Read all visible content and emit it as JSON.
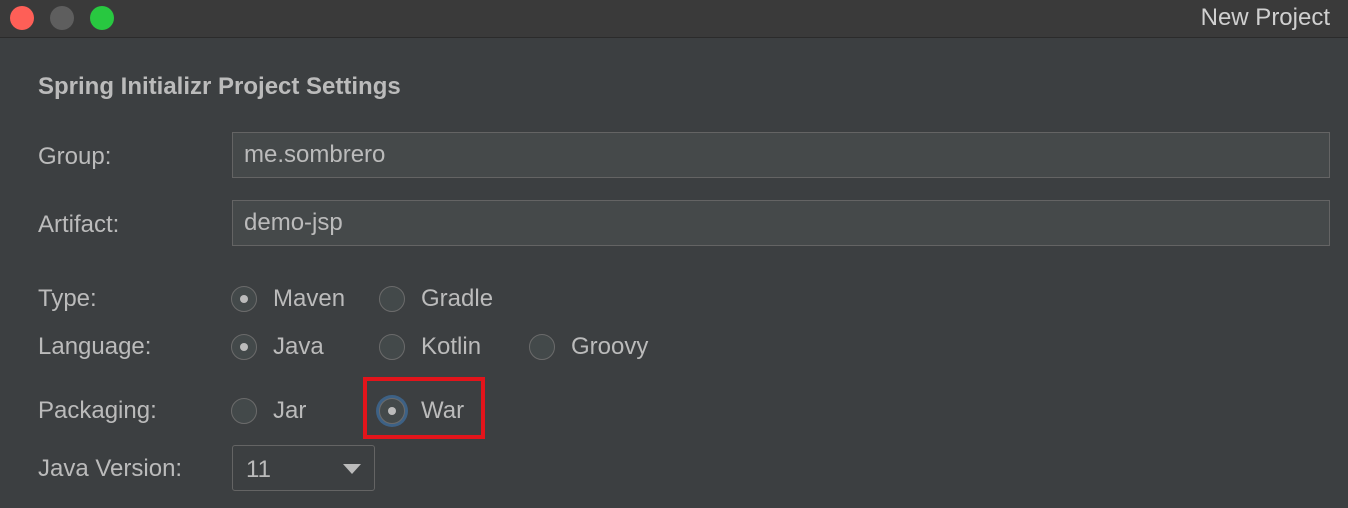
{
  "window": {
    "title": "New Project"
  },
  "form": {
    "section_title": "Spring Initializr Project Settings",
    "group": {
      "label": "Group:",
      "value": "me.sombrero"
    },
    "artifact": {
      "label": "Artifact:",
      "value": "demo-jsp"
    },
    "type": {
      "label": "Type:",
      "options": [
        {
          "label": "Maven",
          "selected": true
        },
        {
          "label": "Gradle",
          "selected": false
        }
      ]
    },
    "language": {
      "label": "Language:",
      "options": [
        {
          "label": "Java",
          "selected": true
        },
        {
          "label": "Kotlin",
          "selected": false
        },
        {
          "label": "Groovy",
          "selected": false
        }
      ]
    },
    "packaging": {
      "label": "Packaging:",
      "options": [
        {
          "label": "Jar",
          "selected": false
        },
        {
          "label": "War",
          "selected": true
        }
      ]
    },
    "java_version": {
      "label": "Java Version:",
      "value": "11"
    }
  },
  "colors": {
    "background": "#3c3f41",
    "field_background": "#45494a",
    "text": "#bbbbbb",
    "highlight": "#e3141b",
    "focus_ring": "#3d6185"
  }
}
